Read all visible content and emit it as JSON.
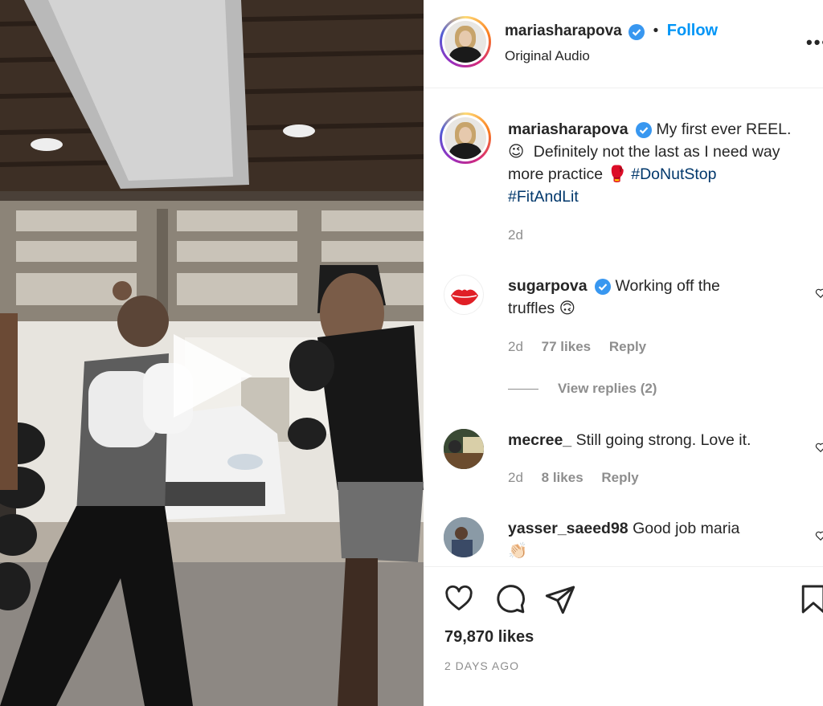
{
  "post": {
    "username": "mariasharapova",
    "follow_label": "Follow",
    "audio": "Original Audio",
    "separator": "•",
    "more": "•••"
  },
  "caption": {
    "username": "mariasharapova",
    "text_line1": "My first ever REEL.",
    "emoji_wink": "😉",
    "text_line2": "Definitely not the last as I need way",
    "text_line3": "more practice",
    "emoji_glove": "🥊",
    "hashtag1": "#DoNutStop",
    "hashtag2": "#FitAndLit",
    "time": "2d"
  },
  "comments": [
    {
      "username": "sugarpova",
      "text_line1": "Working off the",
      "text_line2": "truffles",
      "emoji": "🙃",
      "time": "2d",
      "likes": "77 likes",
      "reply": "Reply",
      "view_replies": "View replies (2)"
    },
    {
      "username": "mecree_",
      "text": "Still going strong. Love it.",
      "time": "2d",
      "likes": "8 likes",
      "reply": "Reply"
    },
    {
      "username": "yasser_saeed98",
      "text": "Good job maria",
      "emoji": "👏🏻"
    }
  ],
  "footer": {
    "likes": "79,870 likes",
    "time_ago": "2 DAYS AGO"
  },
  "colors": {
    "follow_blue": "#0095f6",
    "hashtag_blue": "#00376b",
    "verified_blue": "#3897f0",
    "muted_gray": "#8e8e8e"
  }
}
